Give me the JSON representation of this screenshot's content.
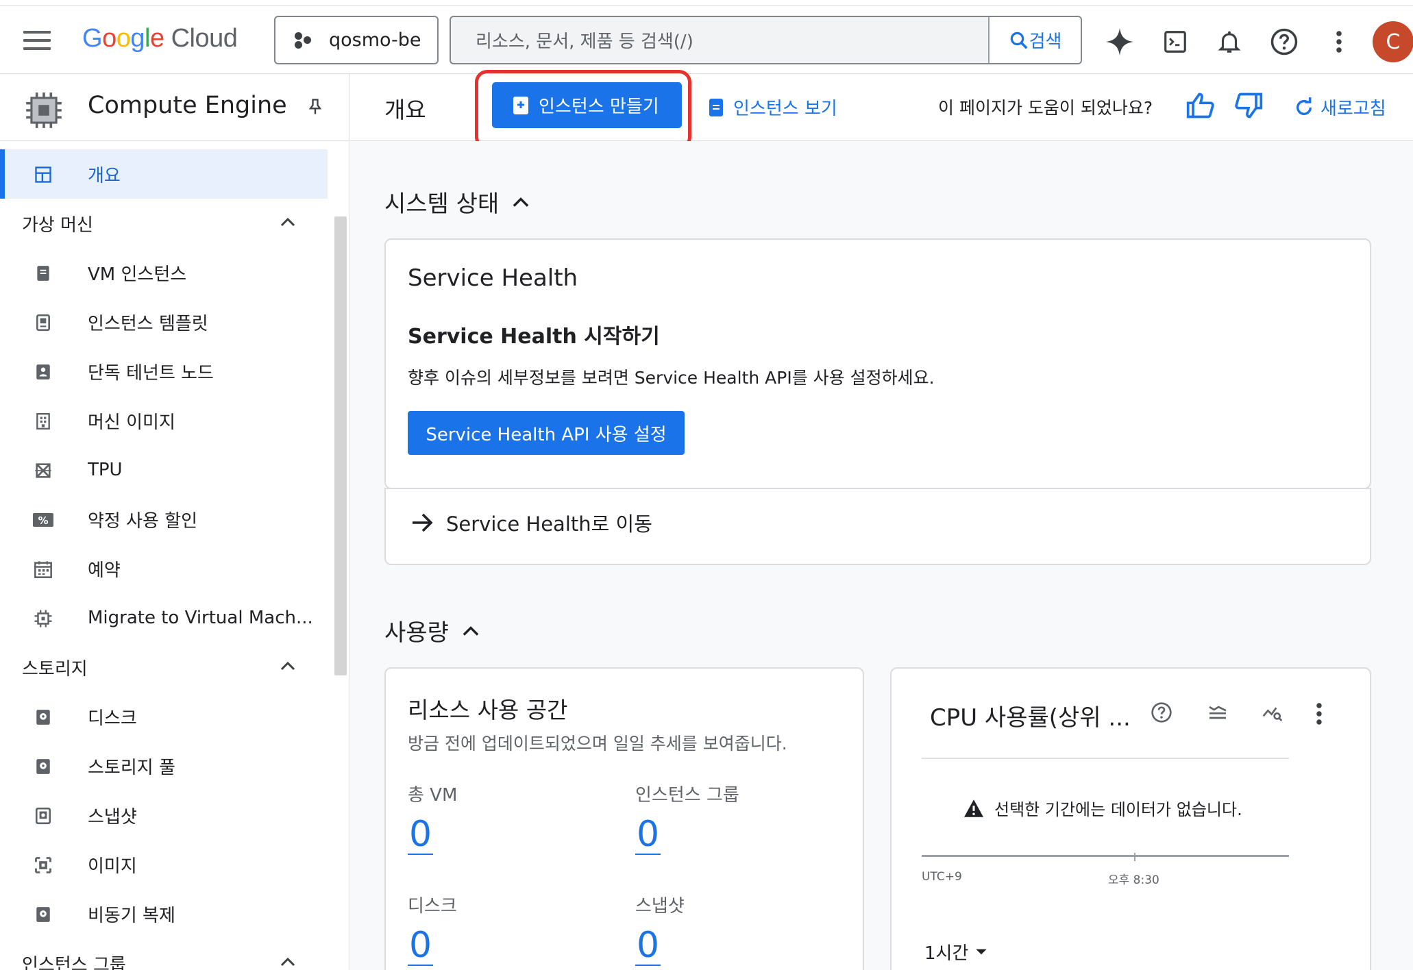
{
  "topbar": {
    "logo_google": "Google",
    "logo_cloud": "Cloud",
    "project": "qosmo-be",
    "search_placeholder": "리소스, 문서, 제품 등 검색(/)",
    "search_button": "검색",
    "avatar_initial": "C",
    "icons": [
      "menu-icon",
      "gemini-sparkle-icon",
      "cloud-shell-icon",
      "bell-icon",
      "help-icon",
      "more-vert-icon"
    ]
  },
  "sidebar": {
    "product_title": "Compute Engine",
    "overview": "개요",
    "sections": [
      {
        "label": "가상 머신",
        "items": [
          {
            "label": "VM 인스턴스",
            "icon": "vm-icon"
          },
          {
            "label": "인스턴스 템플릿",
            "icon": "template-icon"
          },
          {
            "label": "단독 테넌트 노드",
            "icon": "node-icon"
          },
          {
            "label": "머신 이미지",
            "icon": "machine-image-icon"
          },
          {
            "label": "TPU",
            "icon": "tpu-icon"
          },
          {
            "label": "약정 사용 할인",
            "icon": "percent-icon"
          },
          {
            "label": "예약",
            "icon": "calendar-icon"
          },
          {
            "label": "Migrate to Virtual Mach...",
            "icon": "migrate-icon"
          }
        ]
      },
      {
        "label": "스토리지",
        "items": [
          {
            "label": "디스크",
            "icon": "disk-icon"
          },
          {
            "label": "스토리지 풀",
            "icon": "storage-pool-icon"
          },
          {
            "label": "스냅샷",
            "icon": "snapshot-icon"
          },
          {
            "label": "이미지",
            "icon": "image-icon"
          },
          {
            "label": "비동기 복제",
            "icon": "async-replication-icon"
          }
        ]
      },
      {
        "label": "인스턴스 그룹",
        "items": []
      }
    ]
  },
  "toolbar": {
    "title": "개요",
    "create_button": "인스턴스 만들기",
    "view_link": "인스턴스 보기",
    "feedback_question": "이 페이지가 도움이 되었나요?",
    "refresh": "새로고침"
  },
  "system_status": {
    "heading": "시스템 상태",
    "card_title": "Service Health",
    "subtitle": "Service Health 시작하기",
    "description": "향후 이슈의 세부정보를 보려면 Service Health API를 사용 설정하세요.",
    "enable_button": "Service Health API 사용 설정",
    "goto_link": "Service Health로 이동"
  },
  "usage": {
    "heading": "사용량",
    "resources": {
      "title": "리소스 사용 공간",
      "subtitle": "방금 전에 업데이트되었으며 일일 추세를 보여줍니다.",
      "stats": [
        {
          "label": "총 VM",
          "value": "0"
        },
        {
          "label": "인스턴스 그룹",
          "value": "0"
        },
        {
          "label": "디스크",
          "value": "0"
        },
        {
          "label": "스냅샷",
          "value": "0"
        }
      ]
    },
    "cpu": {
      "title": "CPU 사용률(상위 ...",
      "no_data": "선택한 기간에는 데이터가 없습니다.",
      "axis_tz": "UTC+9",
      "axis_time": "오후 8:30",
      "range": "1시간"
    }
  },
  "colors": {
    "accent": "#1a73e8",
    "highlight_box": "#e5322d",
    "avatar": "#c5492a"
  }
}
